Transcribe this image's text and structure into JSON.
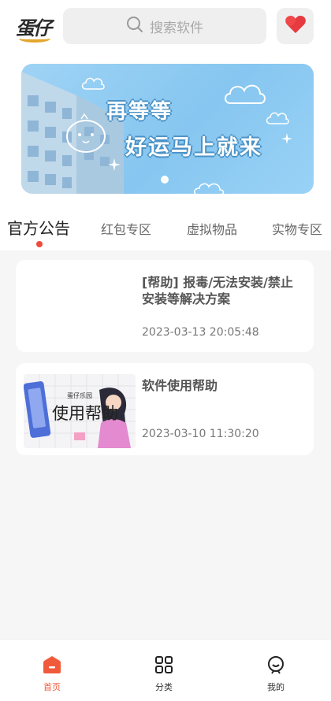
{
  "header": {
    "logo_text": "蛋仔",
    "search_placeholder": "搜索软件",
    "icons": {
      "search": "search-icon",
      "heart": "heart-icon"
    },
    "colors": {
      "heart": "#f0474a",
      "brand": "#e3a72f"
    }
  },
  "banner": {
    "line1": "再等等",
    "line2": "好运马上就来"
  },
  "tabs": [
    {
      "label": "官方公告",
      "active": true
    },
    {
      "label": "红包专区",
      "active": false
    },
    {
      "label": "虚拟物品",
      "active": false
    },
    {
      "label": "实物专区",
      "active": false
    }
  ],
  "posts": [
    {
      "title": "[帮助] 报毒/无法安装/禁止安装等解决方案",
      "date": "2023-03-13 20:05:48",
      "has_thumbnail": false
    },
    {
      "title": "软件使用帮助",
      "date": "2023-03-10 11:30:20",
      "has_thumbnail": true,
      "thumb_caption": "使用帮助",
      "thumb_small": "蛋仔乐园"
    }
  ],
  "tabbar": [
    {
      "label": "首页",
      "icon": "home-icon",
      "active": true
    },
    {
      "label": "分类",
      "icon": "grid-icon",
      "active": false
    },
    {
      "label": "我的",
      "icon": "profile-icon",
      "active": false
    }
  ],
  "accent_color": "#f05a3b"
}
